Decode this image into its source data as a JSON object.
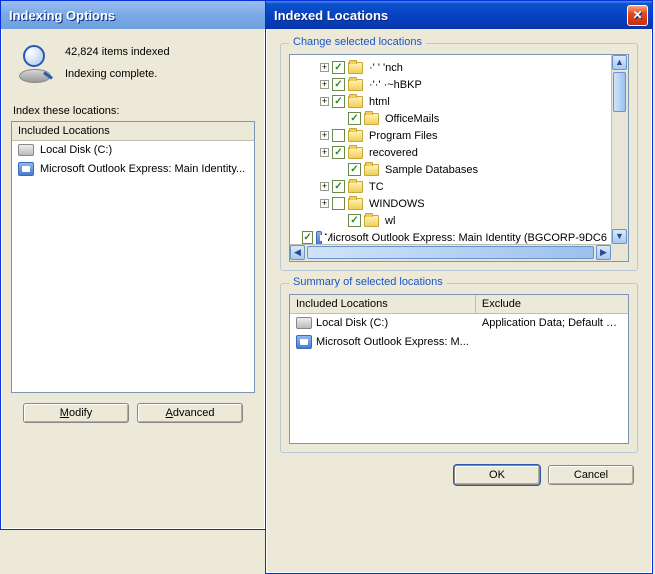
{
  "win1": {
    "title": "Indexing Options",
    "items_indexed": "42,824 items indexed",
    "status": "Indexing complete.",
    "index_these_label": "Index these locations:",
    "list_header": "Included Locations",
    "rows": [
      {
        "icon": "drive",
        "label": "Local Disk (C:)"
      },
      {
        "icon": "outlook",
        "label": "Microsoft Outlook Express: Main Identity..."
      }
    ],
    "modify_label": "Modify",
    "advanced_label": "Advanced"
  },
  "win2": {
    "title": "Indexed Locations",
    "group_change": "Change selected locations",
    "tree": [
      {
        "indent": 28,
        "expand": "+",
        "checked": true,
        "icon": "folder",
        "label": "·' ' 'nch"
      },
      {
        "indent": 28,
        "expand": "+",
        "checked": true,
        "icon": "folder",
        "label": "·'·' ·~hBKP"
      },
      {
        "indent": 28,
        "expand": "+",
        "checked": true,
        "icon": "folder",
        "label": "html"
      },
      {
        "indent": 42,
        "expand": "",
        "checked": true,
        "icon": "folder",
        "label": "OfficeMails"
      },
      {
        "indent": 28,
        "expand": "+",
        "checked": false,
        "icon": "folder",
        "label": "Program Files"
      },
      {
        "indent": 28,
        "expand": "+",
        "checked": true,
        "icon": "folder",
        "label": "recovered"
      },
      {
        "indent": 42,
        "expand": "",
        "checked": true,
        "icon": "folder",
        "label": "Sample Databases"
      },
      {
        "indent": 28,
        "expand": "+",
        "checked": true,
        "icon": "folder",
        "label": "TC"
      },
      {
        "indent": 28,
        "expand": "+",
        "checked": false,
        "icon": "folder",
        "label": "WINDOWS"
      },
      {
        "indent": 42,
        "expand": "",
        "checked": true,
        "icon": "folder",
        "label": "wl"
      },
      {
        "indent": 14,
        "expand": "",
        "checked": true,
        "icon": "outlook",
        "label": "Microsoft Outlook Express: Main Identity (BGCORP-9DC6"
      }
    ],
    "group_summary": "Summary of selected locations",
    "summary_headers": {
      "col1": "Included Locations",
      "col2": "Exclude"
    },
    "summary_rows": [
      {
        "icon": "drive",
        "c1": "Local Disk (C:)",
        "c2": "Application Data; Default User;..."
      },
      {
        "icon": "outlook",
        "c1": "Microsoft Outlook Express: M...",
        "c2": ""
      }
    ],
    "ok_label": "OK",
    "cancel_label": "Cancel"
  }
}
